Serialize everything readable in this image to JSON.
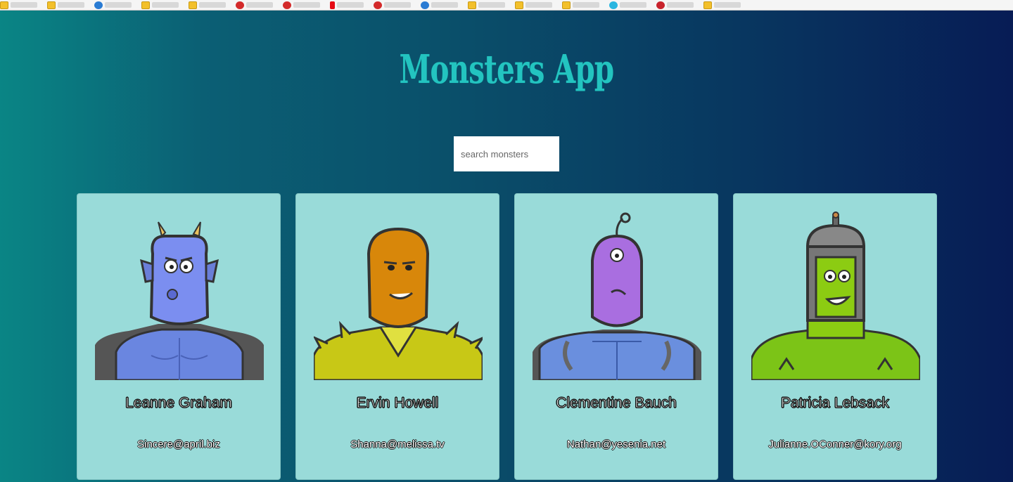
{
  "app": {
    "title": "Monsters App"
  },
  "search": {
    "placeholder": "search monsters",
    "value": ""
  },
  "monsters": [
    {
      "name": "Leanne Graham",
      "email": "Sincere@april.biz",
      "skin": "#7b8ef0",
      "shirt": "#6a86e0",
      "icon": "blue-horned-monster"
    },
    {
      "name": "Ervin Howell",
      "email": "Shanna@melissa.tv",
      "skin": "#d8870a",
      "shirt": "#c8c816",
      "icon": "orange-hooded-monster"
    },
    {
      "name": "Clementine Bauch",
      "email": "Nathan@yesenia.net",
      "skin": "#a96ee0",
      "shirt": "#6a8fde",
      "icon": "purple-cyclops-monster"
    },
    {
      "name": "Patricia Lebsack",
      "email": "Julianne.OConner@kory.org",
      "skin": "#8ccc12",
      "shirt": "#7cc417",
      "icon": "green-robot-monster"
    }
  ],
  "colors": {
    "title": "#23c4c0",
    "card_background": "#99dbd9",
    "gradient_start": "#0a8585",
    "gradient_end": "#071c55"
  }
}
